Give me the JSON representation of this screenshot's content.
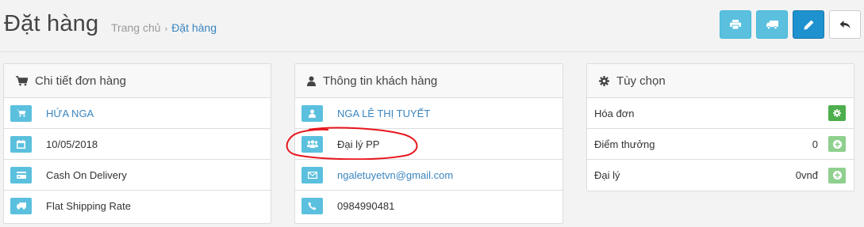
{
  "header": {
    "title": "Đặt hàng",
    "breadcrumb": {
      "home": "Trang chủ",
      "separator": "›",
      "current": "Đặt hàng"
    },
    "buttons": [
      {
        "icon": "print-icon"
      },
      {
        "icon": "truck-icon"
      },
      {
        "icon": "pencil-icon"
      },
      {
        "icon": "reply-icon"
      }
    ]
  },
  "order_panel": {
    "title": "Chi tiết đơn hàng",
    "rows": [
      {
        "icon": "cart-icon",
        "text": "HỨA NGA"
      },
      {
        "icon": "calendar-icon",
        "text": "10/05/2018"
      },
      {
        "icon": "credit-card-icon",
        "text": "Cash On Delivery"
      },
      {
        "icon": "truck-icon",
        "text": "Flat Shipping Rate"
      }
    ]
  },
  "customer_panel": {
    "title": "Thông tin khách hàng",
    "rows": [
      {
        "icon": "user-icon",
        "text": "NGA LÊ THỊ TUYẾT"
      },
      {
        "icon": "users-icon",
        "text": "Đại lý PP"
      },
      {
        "icon": "envelope-icon",
        "text": "ngaletuyetvn@gmail.com"
      },
      {
        "icon": "phone-icon",
        "text": "0984990481"
      }
    ]
  },
  "options_panel": {
    "title": "Tùy chọn",
    "rows": [
      {
        "label": "Hóa đơn",
        "value": "",
        "button": "gear-icon"
      },
      {
        "label": "Điểm thưởng",
        "value": "0",
        "button": "plus-circle-icon"
      },
      {
        "label": "Đại lý",
        "value": "0vnđ",
        "button": "plus-circle-icon"
      }
    ]
  },
  "colors": {
    "info": "#5bc0de",
    "primary": "#1e91cf",
    "link": "#3a85bf",
    "success": "#4cae4c",
    "success_light": "#8fd08f",
    "annotation": "#e8141c"
  }
}
